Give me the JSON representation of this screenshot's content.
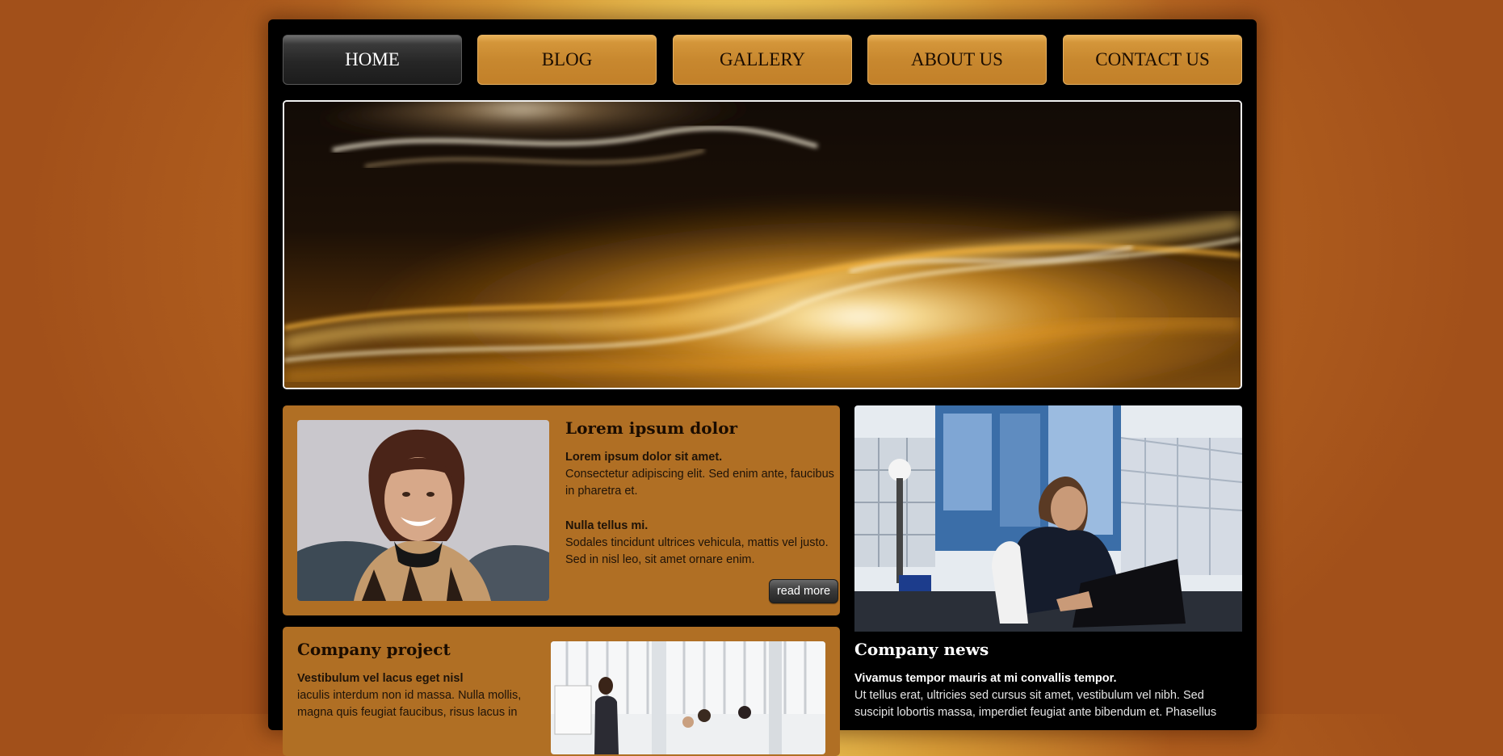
{
  "nav": {
    "items": [
      {
        "label": "HOME",
        "active": true
      },
      {
        "label": "BLOG",
        "active": false
      },
      {
        "label": "GALLERY",
        "active": false
      },
      {
        "label": "ABOUT US",
        "active": false
      },
      {
        "label": "CONTACT US",
        "active": false
      }
    ]
  },
  "feature": {
    "title": "Lorem ipsum dolor",
    "p1_strong": "Lorem ipsum dolor sit amet.",
    "p1_text": "Consectetur adipiscing elit. Sed enim ante, faucibus in pharetra et.",
    "p2_strong": "Nulla tellus mi.",
    "p2_text": "Sodales tincidunt ultrices vehicula, mattis vel justo. Sed in nisl leo, sit amet ornare enim.",
    "read_more": "read more"
  },
  "project": {
    "title": "Company project",
    "strong": "Vestibulum vel lacus eget nisl",
    "text": "iaculis interdum non id massa. Nulla mollis, magna quis feugiat faucibus, risus lacus in"
  },
  "news": {
    "title": "Company news",
    "strong": "Vivamus tempor mauris at mi convallis tempor.",
    "text": "Ut tellus erat, ultricies sed cursus sit amet, vestibulum vel nibh. Sed suscipit lobortis massa, imperdiet feugiat ante bibendum et. Phasellus"
  },
  "colors": {
    "accent": "#c8882f",
    "box_bg": "#b06f24",
    "frame": "#000000"
  }
}
